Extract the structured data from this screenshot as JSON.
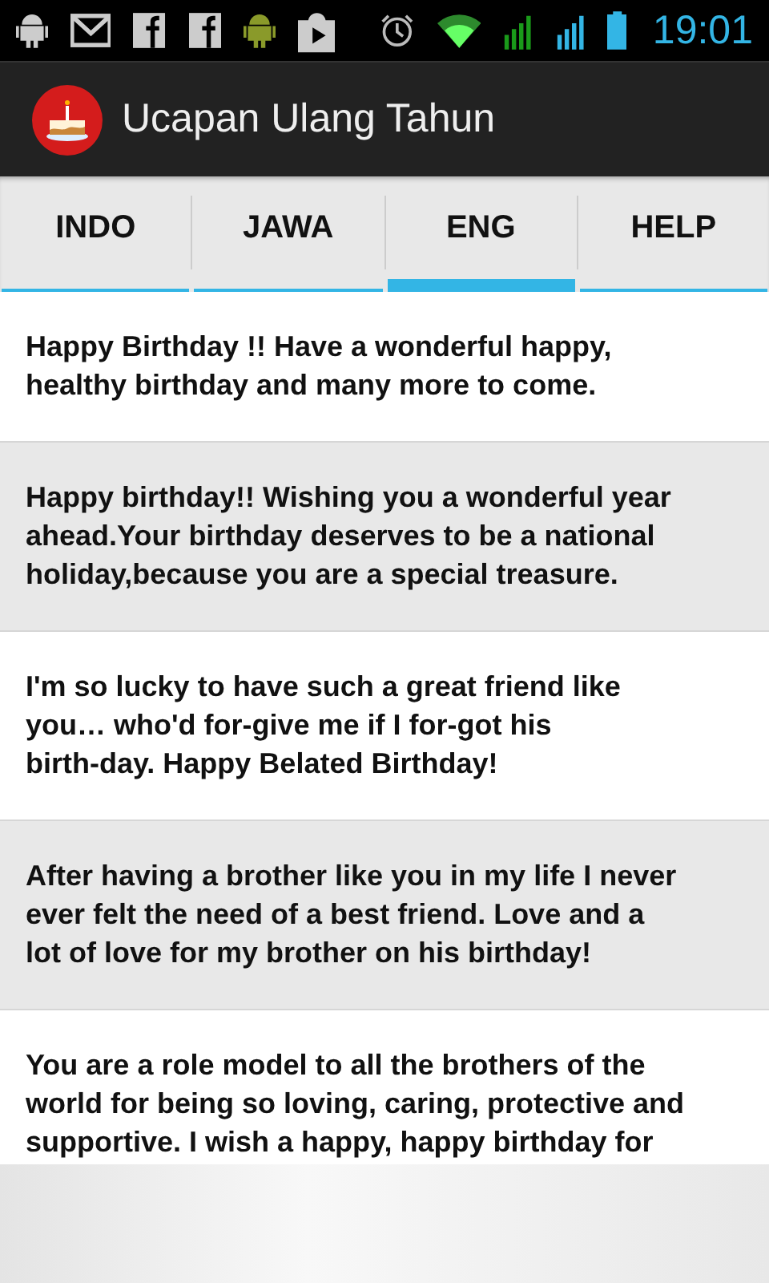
{
  "status_bar": {
    "time": "19:01"
  },
  "action_bar": {
    "title": "Ucapan Ulang Tahun"
  },
  "tabs": [
    {
      "label": "INDO",
      "selected": false
    },
    {
      "label": "JAWA",
      "selected": false
    },
    {
      "label": "ENG",
      "selected": true
    },
    {
      "label": "HELP",
      "selected": false
    }
  ],
  "messages": [
    {
      "text": "Happy Birthday !! Have a wonderful happy,\nhealthy birthday and many more to come.",
      "shaded": false
    },
    {
      "text": "Happy birthday!! Wishing you a wonderful year\nahead.Your birthday deserves to be a national\nholiday,because you are a special treasure.",
      "shaded": true
    },
    {
      "text": "I'm so lucky to have such a great friend like\nyou… who'd for-give me if I for-got his\nbirth-day. Happy Belated Birthday!",
      "shaded": false
    },
    {
      "text": "After having a brother like you in my life I never\never felt the need of a best friend. Love and a\nlot of love for my brother on his birthday!",
      "shaded": true
    },
    {
      "text": "You are a role model to all the brothers of the\nworld for being so loving, caring, protective and\nsupportive. I wish a happy, happy birthday for",
      "shaded": false
    }
  ]
}
